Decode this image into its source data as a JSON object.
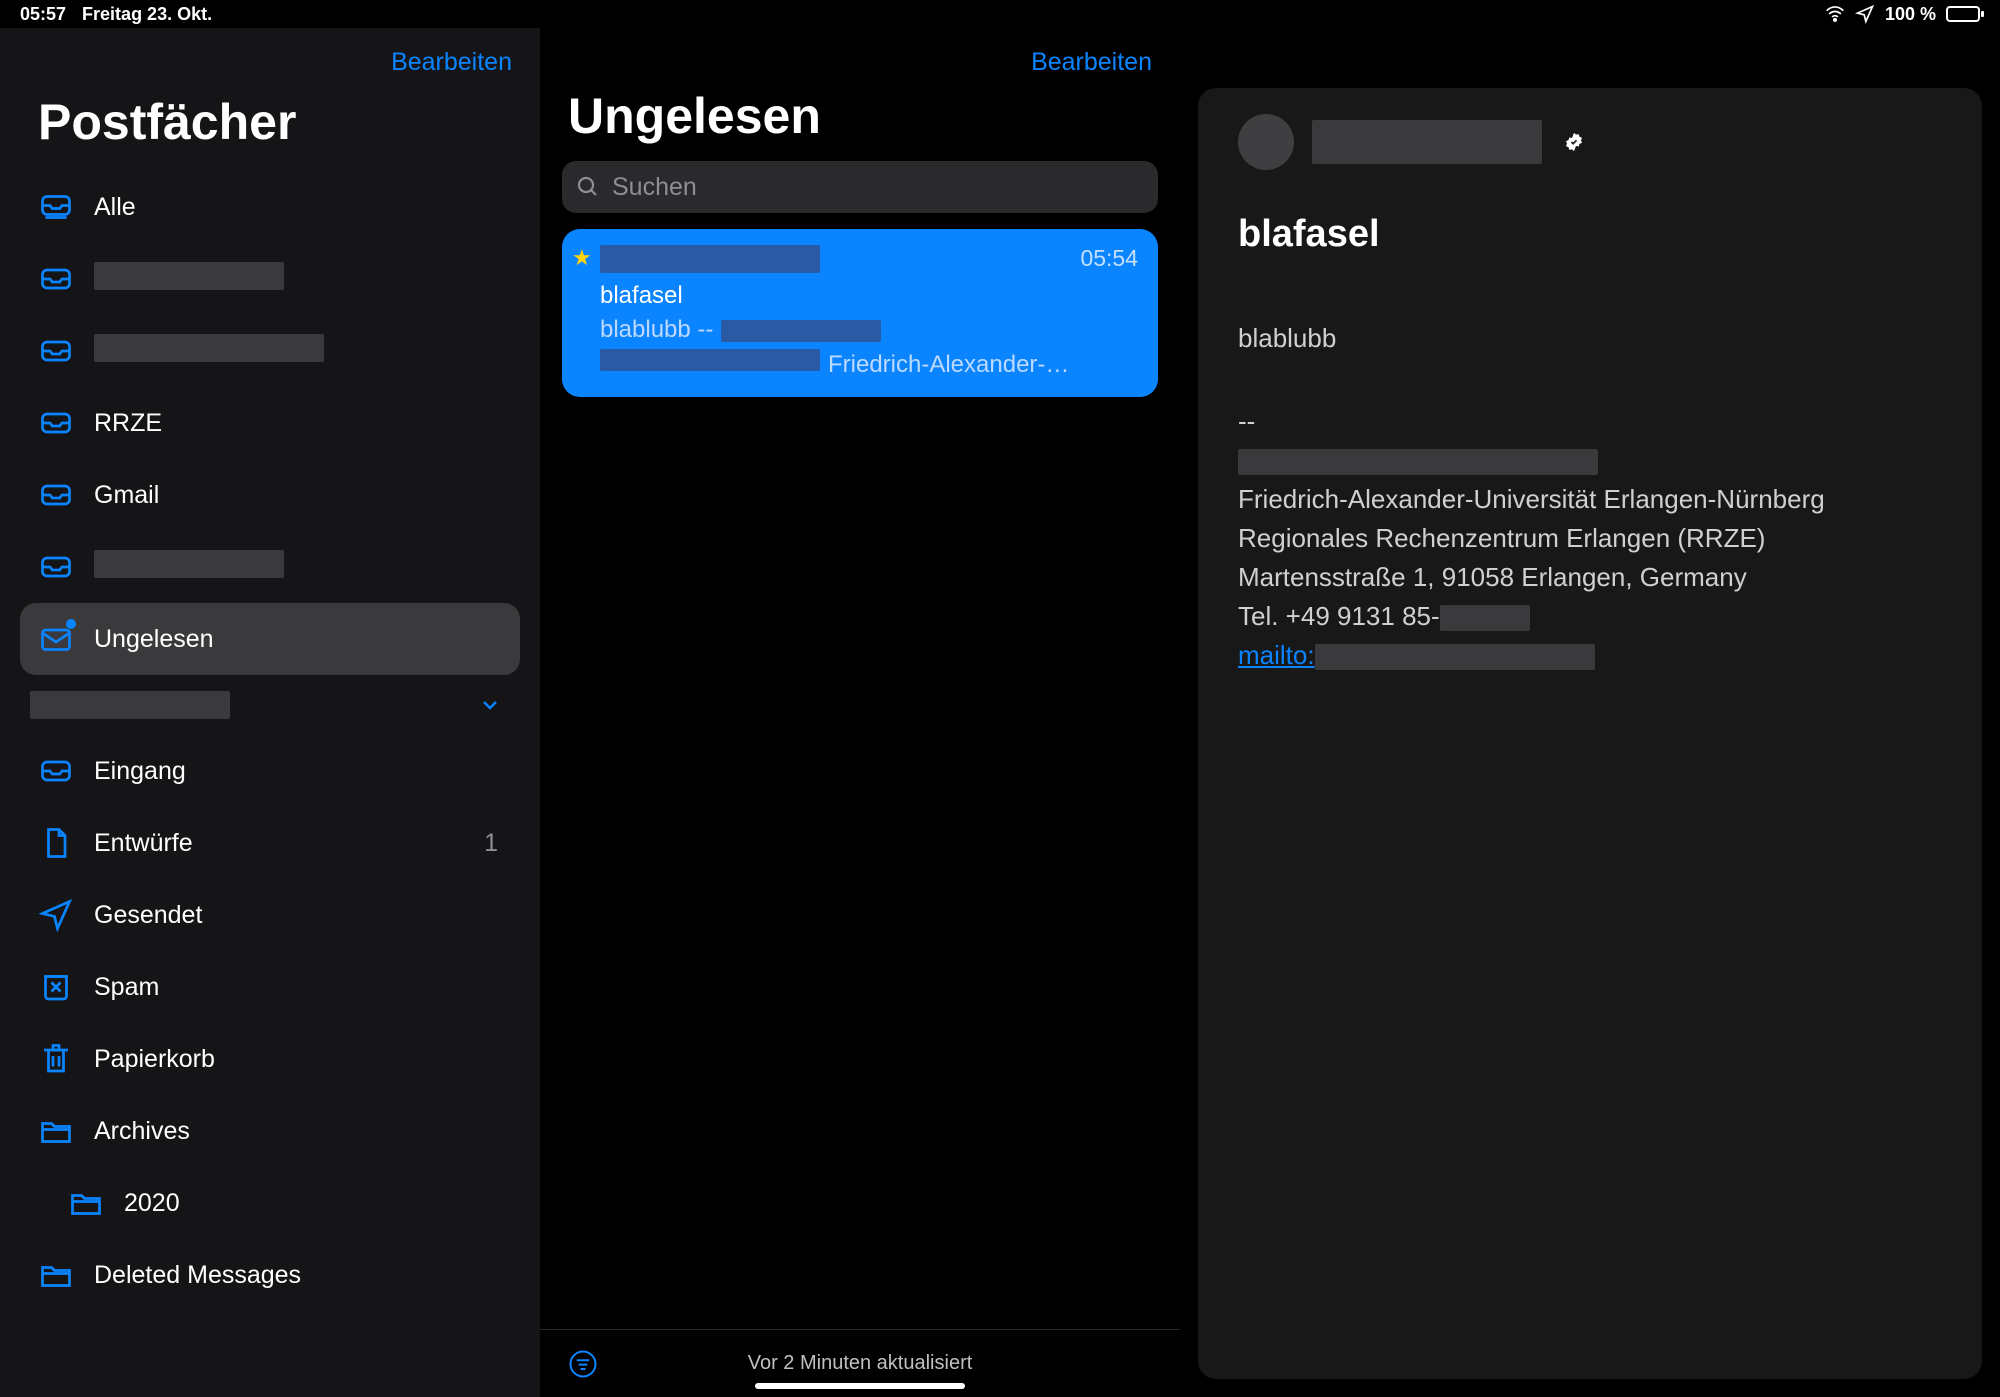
{
  "statusbar": {
    "time": "05:57",
    "date": "Freitag 23. Okt.",
    "battery": "100 %"
  },
  "sidebar": {
    "edit_label": "Bearbeiten",
    "title": "Postfächer",
    "items": [
      {
        "icon": "tray-all",
        "label": "Alle",
        "redacted": false
      },
      {
        "icon": "tray",
        "label": "",
        "redacted": true,
        "redact_w": 190
      },
      {
        "icon": "tray",
        "label": "",
        "redacted": true,
        "redact_w": 230
      },
      {
        "icon": "tray",
        "label": "RRZE",
        "redacted": false
      },
      {
        "icon": "tray",
        "label": "Gmail",
        "redacted": false
      },
      {
        "icon": "tray",
        "label": "",
        "redacted": true,
        "redact_w": 190
      },
      {
        "icon": "envelope-dot",
        "label": "Ungelesen",
        "redacted": false,
        "selected": true
      }
    ],
    "account_header_redacted": true,
    "folders": [
      {
        "icon": "tray",
        "label": "Eingang"
      },
      {
        "icon": "doc",
        "label": "Entwürfe",
        "count": "1"
      },
      {
        "icon": "send",
        "label": "Gesendet"
      },
      {
        "icon": "junk",
        "label": "Spam"
      },
      {
        "icon": "trash",
        "label": "Papierkorb"
      },
      {
        "icon": "folder",
        "label": "Archives"
      },
      {
        "icon": "folder",
        "label": "2020",
        "indent": true
      },
      {
        "icon": "folder",
        "label": "Deleted Messages"
      }
    ]
  },
  "messagelist": {
    "edit_label": "Bearbeiten",
    "title": "Ungelesen",
    "search_placeholder": "Suchen",
    "footer_status": "Vor 2 Minuten aktualisiert",
    "message": {
      "starred": true,
      "time": "05:54",
      "subject": "blafasel",
      "preview_prefix": "blablubb --",
      "preview_suffix": "Friedrich-Alexander-…"
    }
  },
  "detail": {
    "subject": "blafasel",
    "body_line1": "blablubb",
    "sig_sep": "--",
    "sig_line2": "Friedrich-Alexander-Universität Erlangen-Nürnberg",
    "sig_line3": "Regionales Rechenzentrum Erlangen (RRZE)",
    "sig_line4": "Martensstraße 1, 91058 Erlangen, Germany",
    "sig_tel_prefix": "Tel. +49 9131 85-",
    "sig_mailto_prefix": "mailto:"
  }
}
